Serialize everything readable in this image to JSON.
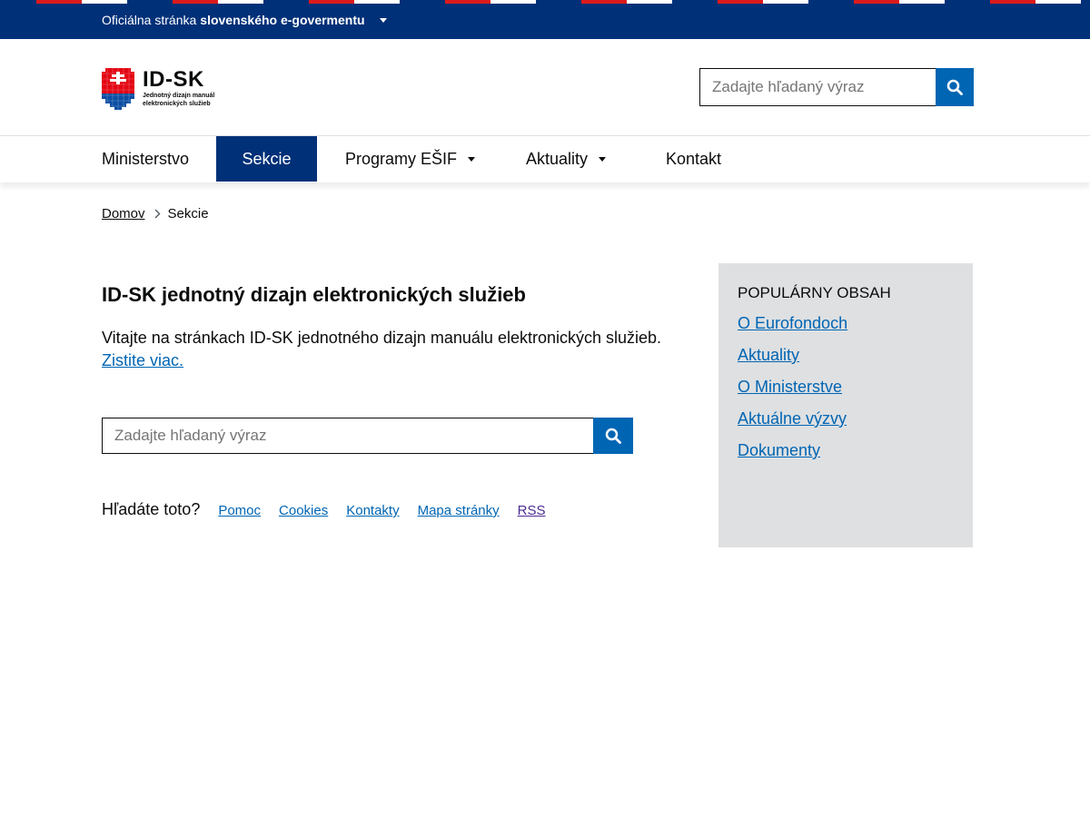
{
  "colors": {
    "gov_bar": "#003078",
    "accent": "#0065b3",
    "flag_red": "#de1b1b",
    "sidebar_bg": "#dee0e2"
  },
  "gov_bar": {
    "label_prefix": "Oficiálna stránka",
    "label_bold": "slovenského e-govermentu",
    "caret_icon": "caret-down-icon"
  },
  "logo": {
    "title": "ID-SK",
    "subtitle_line1": "Jednotný dizajn manuál",
    "subtitle_line2": "elektronických služieb",
    "icon": "slovak-coat-of-arms-icon"
  },
  "header_search": {
    "placeholder": "Zadajte hľadaný výraz",
    "button_icon": "search-icon"
  },
  "nav": {
    "items": [
      {
        "label": "Ministerstvo",
        "active": false,
        "dropdown": false
      },
      {
        "label": "Sekcie",
        "active": true,
        "dropdown": false
      },
      {
        "label": "Programy EŠIF",
        "active": false,
        "dropdown": true
      },
      {
        "label": "Aktuality",
        "active": false,
        "dropdown": true
      },
      {
        "label": "Kontakt",
        "active": false,
        "dropdown": false
      }
    ]
  },
  "breadcrumb": {
    "home": "Domov",
    "current": "Sekcie"
  },
  "main": {
    "title": "ID-SK jednotný dizajn elektronických služieb",
    "intro": "Vitajte na stránkach ID-SK jednotného dizajn manuálu elektronických služieb.",
    "intro_link": "Zistite viac.",
    "search_placeholder": "Zadajte hľadaný výraz",
    "quick_label": "Hľadáte toto?",
    "quick_links": [
      "Pomoc",
      "Cookies",
      "Kontakty",
      "Mapa stránky",
      "RSS"
    ]
  },
  "sidebar": {
    "title": "POPULÁRNY OBSAH",
    "links": [
      "O Eurofondoch",
      "Aktuality",
      "O Ministerstve",
      "Aktuálne výzvy",
      "Dokumenty"
    ]
  }
}
